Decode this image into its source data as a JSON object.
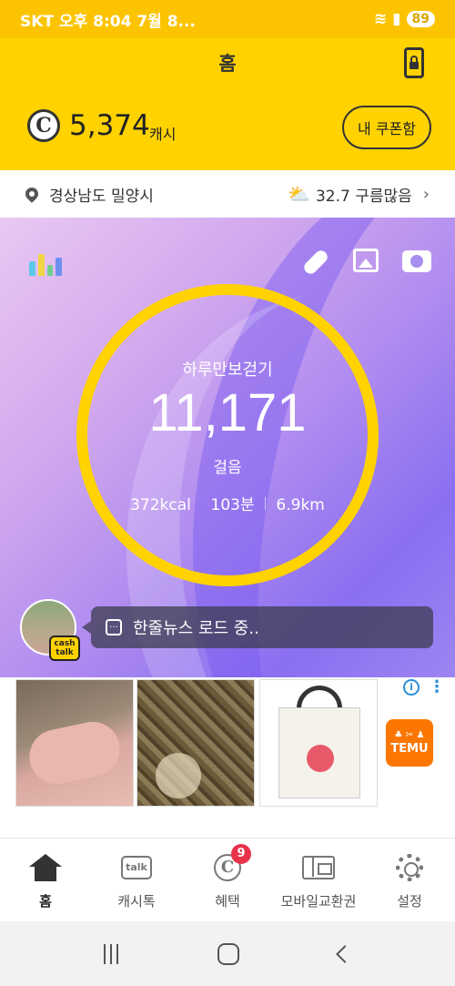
{
  "status_bar": {
    "carrier_time": "SKT 오후 8:04  7월 8...",
    "battery": "89"
  },
  "header": {
    "title": "홈",
    "cash_amount": "5,374",
    "cash_unit": "캐시",
    "coupon_button": "내 쿠폰함",
    "coin_symbol": "C"
  },
  "location": {
    "place": "경상남도 밀양시",
    "weather": "32.7 구름많음"
  },
  "pedometer": {
    "label": "하루만보걷기",
    "steps": "11,171",
    "steps_unit": "걸음",
    "kcal": "372kcal",
    "minutes": "103분",
    "distance": "6.9km"
  },
  "news": {
    "badge_line1": "cash",
    "badge_line2": "talk",
    "text": "한줄뉴스 로드 중.."
  },
  "ad": {
    "brand": "TEMU",
    "brand_color": "#fb7701"
  },
  "bottom_nav": {
    "items": [
      {
        "label": "홈",
        "icon": "home-icon"
      },
      {
        "label": "캐시톡",
        "icon": "talk-icon"
      },
      {
        "label": "혜택",
        "icon": "benefit-icon",
        "badge": "9"
      },
      {
        "label": "모바일교환권",
        "icon": "voucher-icon"
      },
      {
        "label": "설정",
        "icon": "gear-icon"
      }
    ],
    "talk_icon_text": "talk",
    "benefit_icon_text": "C"
  },
  "colors": {
    "accent_yellow": "#ffd200",
    "badge_red": "#e8334a"
  }
}
